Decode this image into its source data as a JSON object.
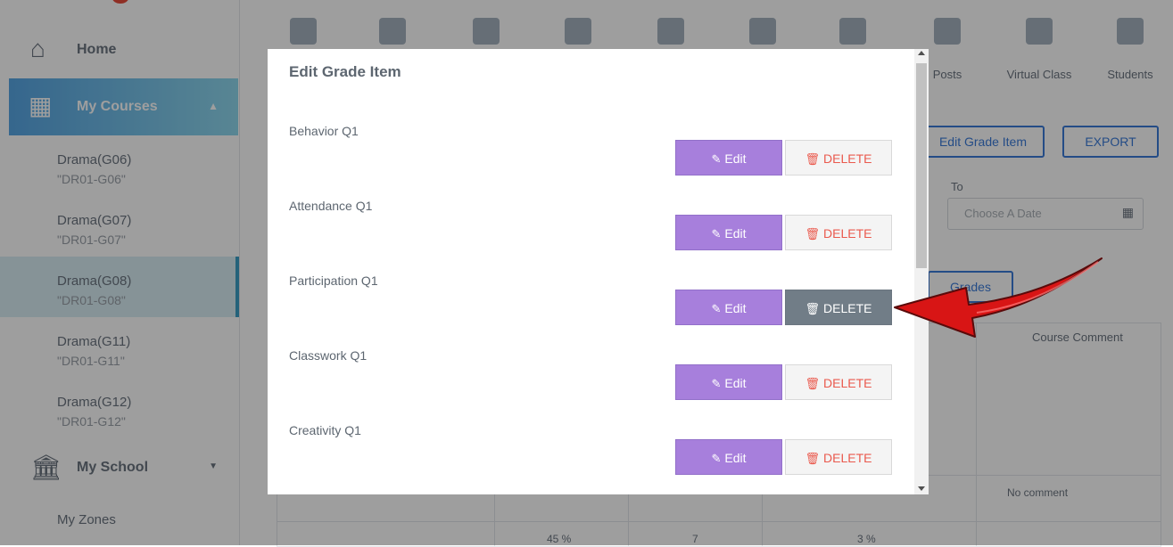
{
  "sidebar": {
    "home_label": "Home",
    "courses_label": "My Courses",
    "courses": [
      {
        "name": "Drama(G06)",
        "code": "\"DR01-G06\""
      },
      {
        "name": "Drama(G07)",
        "code": "\"DR01-G07\""
      },
      {
        "name": "Drama(G08)",
        "code": "\"DR01-G08\""
      },
      {
        "name": "Drama(G11)",
        "code": "\"DR01-G11\""
      },
      {
        "name": "Drama(G12)",
        "code": "\"DR01-G12\""
      }
    ],
    "school_label": "My School",
    "zones_label": "My Zones"
  },
  "topnav": {
    "items": [
      {
        "label": "",
        "icon": "assignment-icon"
      },
      {
        "label": "",
        "icon": "gradebook-icon"
      },
      {
        "label": "",
        "icon": "chart-icon"
      },
      {
        "label": "",
        "icon": "quiz-icon"
      },
      {
        "label": "",
        "icon": "calendar-icon"
      },
      {
        "label": "",
        "icon": "resources-icon"
      },
      {
        "label": "",
        "icon": "profile-icon"
      },
      {
        "label": "Posts",
        "icon": "chat-icon"
      },
      {
        "label": "Virtual Class",
        "icon": "virtual-class-icon"
      },
      {
        "label": "Students",
        "icon": "students-icon"
      }
    ]
  },
  "toolbar": {
    "edit_grade_item": "Edit Grade Item",
    "export": "EXPORT",
    "to_label": "To",
    "date_placeholder": "Choose A Date",
    "grades_label": "Grades"
  },
  "table": {
    "course_comment": "Course Comment",
    "no_comment": "No comment",
    "cells": [
      "45 %",
      "7",
      "3 %"
    ]
  },
  "modal": {
    "title": "Edit Grade Item",
    "edit_label": "Edit",
    "delete_label": "DELETE",
    "items": [
      {
        "name": "Behavior Q1"
      },
      {
        "name": "Attendance Q1"
      },
      {
        "name": "Participation Q1"
      },
      {
        "name": "Classwork Q1"
      },
      {
        "name": "Creativity Q1"
      }
    ]
  },
  "colors": {
    "edit_button": "#a77fdc",
    "delete_text": "#ea5a4e",
    "delete_hover": "#717d87",
    "arrow": "#d81515"
  }
}
